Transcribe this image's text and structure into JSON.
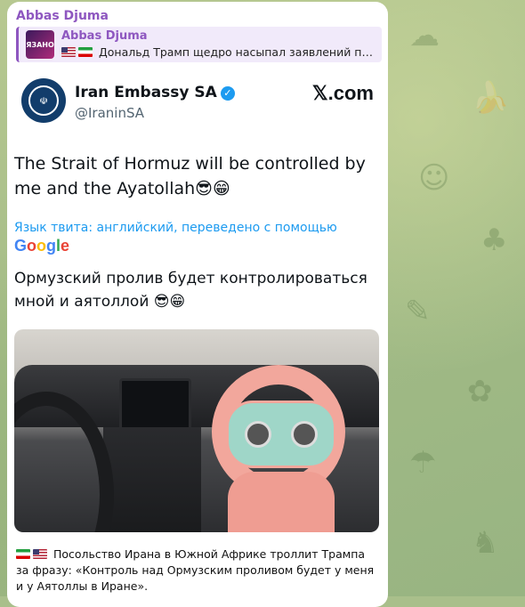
{
  "message": {
    "sender": "Abbas Djuma",
    "reply": {
      "thumb_label": "ЯЗАНО",
      "name": "Abbas Djuma",
      "text": "Дональд Трамп щедро насыпал заявлений по И..."
    },
    "tweet": {
      "name": "Iran Embassy SA",
      "handle": "@IraninSA",
      "brand": "𝕏.com",
      "text_en": "The Strait of Hormuz will be controlled by me and the Ayatollah😎😁",
      "translate_note": "Язык твита: английский, переведено с помощью",
      "text_ru": "Ормузский пролив будет контролироваться мной и аятоллой 😎😁"
    },
    "caption": "Посольство Ирана в Южной Африке троллит Трампа за фразу: «Контроль над Ормузским проливом будет у меня и у Аятоллы в Иране»."
  },
  "colors": {
    "sender": "#8e57c0",
    "link": "#1d9bf0",
    "verified": "#1d9bf0"
  },
  "icons": [
    "flag-us-icon",
    "flag-iran-icon",
    "verified-icon",
    "x-logo-icon",
    "google-logo-icon"
  ]
}
